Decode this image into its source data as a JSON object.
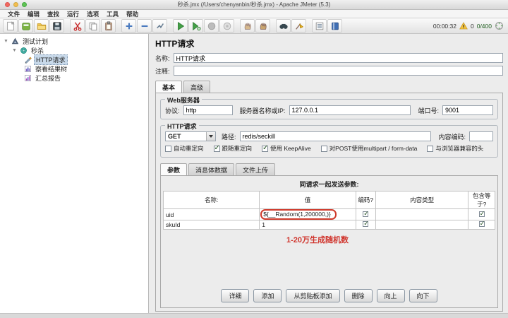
{
  "window": {
    "title": "秒杀.jmx (/Users/chenyanbin/秒杀.jmx) - Apache JMeter (5.3)"
  },
  "menu": {
    "items": [
      "文件",
      "编辑",
      "查找",
      "运行",
      "选项",
      "工具",
      "帮助"
    ]
  },
  "toolbar": {
    "icons": [
      "new-file",
      "templates",
      "open-folder",
      "save",
      "cut",
      "copy",
      "paste",
      "expand-all",
      "collapse-all",
      "toggle",
      "start",
      "start-no-pauses",
      "stop",
      "shutdown",
      "remote-start-all",
      "remote-stop-all",
      "search",
      "clear-search",
      "function-helper",
      "help"
    ],
    "timer": "00:00:32",
    "warning_count": "0",
    "thread_count": "0/400",
    "warning_color": "#f0ad1e",
    "thread_color": "#1c5c1c"
  },
  "tree": {
    "items": [
      {
        "label": "测试计划",
        "icon": "test-plan",
        "level": 0,
        "selected": false
      },
      {
        "label": "秒杀",
        "icon": "thread-group",
        "level": 1,
        "selected": false
      },
      {
        "label": "HTTP请求",
        "icon": "http-request",
        "level": 2,
        "selected": true
      },
      {
        "label": "察看结果树",
        "icon": "results-tree",
        "level": 2,
        "selected": false
      },
      {
        "label": "汇总报告",
        "icon": "summary-report",
        "level": 2,
        "selected": false
      }
    ]
  },
  "main": {
    "title": "HTTP请求",
    "name_label": "名称:",
    "name_value": "HTTP请求",
    "comment_label": "注释:",
    "comment_value": "",
    "tabs": [
      {
        "label": "基本",
        "active": true
      },
      {
        "label": "高级",
        "active": false
      }
    ],
    "web_server": {
      "title": "Web服务器",
      "protocol_label": "协议:",
      "protocol_value": "http",
      "server_label": "服务器名称或IP:",
      "server_value": "127.0.0.1",
      "port_label": "端口号:",
      "port_value": "9001"
    },
    "http_request": {
      "title": "HTTP请求",
      "method_value": "GET",
      "path_label": "路径:",
      "path_value": "redis/seckill",
      "encoding_label": "内容编码:",
      "encoding_value": "",
      "checkboxes": [
        {
          "label": "自动重定向",
          "checked": false
        },
        {
          "label": "跟随重定向",
          "checked": true
        },
        {
          "label": "使用 KeepAlive",
          "checked": true
        },
        {
          "label": "对POST使用multipart / form-data",
          "checked": false
        },
        {
          "label": "与浏览器兼容的头",
          "checked": false
        }
      ]
    },
    "body_tabs": [
      {
        "label": "参数",
        "active": true
      },
      {
        "label": "消息体数据",
        "active": false
      },
      {
        "label": "文件上传",
        "active": false
      }
    ],
    "params": {
      "caption": "同请求一起发送参数:",
      "columns": [
        "名称:",
        "值",
        "编码?",
        "内容类型",
        "包含等于?"
      ],
      "rows": [
        {
          "name": "uid",
          "value": "${__Random(1,200000,)}",
          "encode": true,
          "content_type": "",
          "include_equals": true,
          "highlighted": true
        },
        {
          "name": "skuId",
          "value": "1",
          "encode": true,
          "content_type": "",
          "include_equals": true,
          "highlighted": false
        }
      ],
      "annotation": "1-20万生成随机数",
      "annotation_color": "#d0342c"
    },
    "buttons": [
      "详细",
      "添加",
      "从剪贴板添加",
      "删除",
      "向上",
      "向下"
    ]
  }
}
